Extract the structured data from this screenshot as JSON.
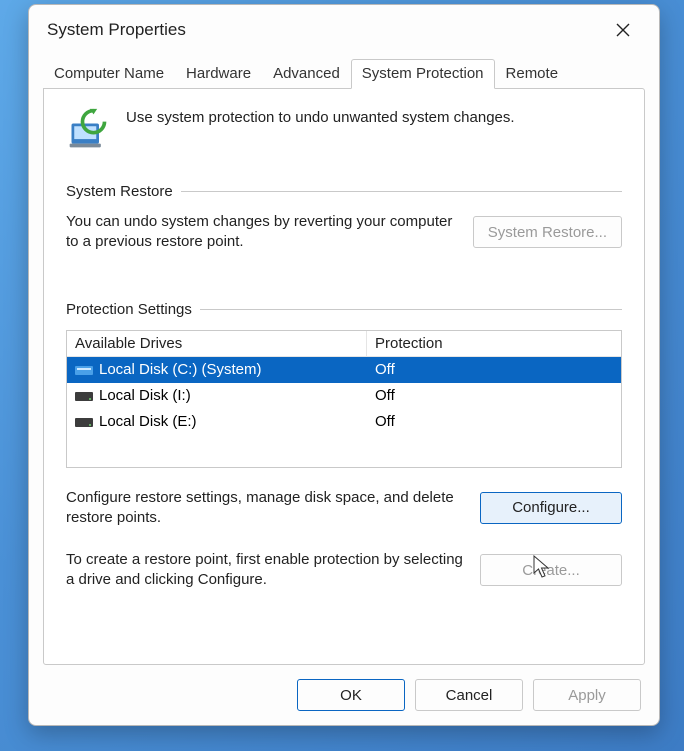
{
  "window": {
    "title": "System Properties"
  },
  "tabs": [
    {
      "label": "Computer Name"
    },
    {
      "label": "Hardware"
    },
    {
      "label": "Advanced"
    },
    {
      "label": "System Protection",
      "active": true
    },
    {
      "label": "Remote"
    }
  ],
  "intro": {
    "text": "Use system protection to undo unwanted system changes.",
    "icon": "restore-icon"
  },
  "restore_group": {
    "header": "System Restore",
    "desc": "You can undo system changes by reverting your computer to a previous restore point.",
    "button": "System Restore...",
    "button_enabled": false
  },
  "protection_group": {
    "header": "Protection Settings",
    "columns": {
      "drive": "Available Drives",
      "protection": "Protection"
    },
    "drives": [
      {
        "label": "Local Disk (C:) (System)",
        "protection": "Off",
        "selected": true,
        "icon": "system-drive-icon"
      },
      {
        "label": "Local Disk (I:)",
        "protection": "Off",
        "selected": false,
        "icon": "drive-icon"
      },
      {
        "label": "Local Disk (E:)",
        "protection": "Off",
        "selected": false,
        "icon": "drive-icon"
      }
    ],
    "configure_desc": "Configure restore settings, manage disk space, and delete restore points.",
    "configure_button": "Configure...",
    "create_desc": "To create a restore point, first enable protection by selecting a drive and clicking Configure.",
    "create_button": "Create...",
    "create_enabled": false
  },
  "footer": {
    "ok": "OK",
    "cancel": "Cancel",
    "apply": "Apply",
    "apply_enabled": false
  },
  "colors": {
    "selection": "#0a66c2",
    "border": "#c9c9c9",
    "disabled_text": "#9a9a9a"
  }
}
